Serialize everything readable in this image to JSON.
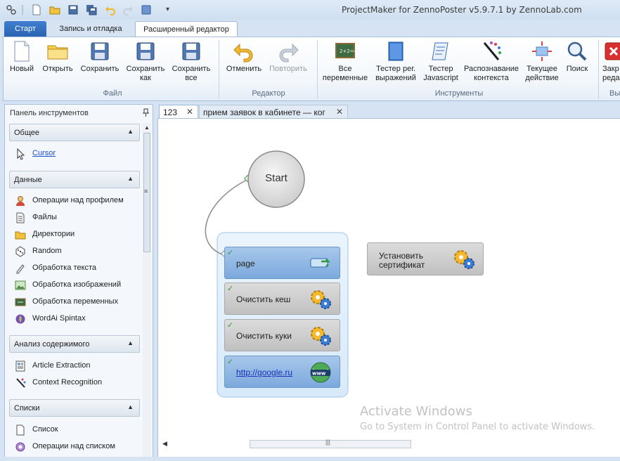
{
  "app": {
    "title": "ProjectMaker for ZennoPoster v5.9.7.1 by ZennoLab.com"
  },
  "quick_access": [
    "app-icon",
    "new-icon",
    "open-icon",
    "save-icon",
    "save-all-icon",
    "undo-icon",
    "redo-icon",
    "layout-icon",
    "customize-icon"
  ],
  "tabs": [
    {
      "label": "Старт",
      "active": false
    },
    {
      "label": "Запись и отладка",
      "active": false
    },
    {
      "label": "Расширенный редактор",
      "active": true
    }
  ],
  "ribbon": {
    "groups": [
      {
        "label": "Файл"
      },
      {
        "label": "Редактор"
      },
      {
        "label": "Инструменты"
      },
      {
        "label": "Вы"
      }
    ],
    "buttons": {
      "new": "Новый",
      "open": "Открыть",
      "save": "Сохранить",
      "save_as_1": "Сохранить",
      "save_as_2": "как",
      "save_all_1": "Сохранить",
      "save_all_2": "все",
      "undo": "Отменить",
      "redo": "Повторить",
      "all_vars_1": "Все",
      "all_vars_2": "переменные",
      "regex_1": "Тестер рег.",
      "regex_2": "выражений",
      "js_1": "Тестер",
      "js_2": "Javascript",
      "ctx_1": "Распознавание",
      "ctx_2": "контекста",
      "cur_1": "Текущее",
      "cur_2": "действие",
      "search": "Поиск",
      "close_1": "Закр",
      "close_2": "реда"
    }
  },
  "toolpanel": {
    "title": "Панель инструментов",
    "pin": "ᵖ",
    "sections": [
      {
        "title": "Общее",
        "items": [
          {
            "label": "Cursor",
            "icon": "cursor-icon"
          }
        ]
      },
      {
        "title": "Данные",
        "items": [
          {
            "label": "Операции над профилем",
            "icon": "profile-icon"
          },
          {
            "label": "Файлы",
            "icon": "file-icon"
          },
          {
            "label": "Директории",
            "icon": "folder-icon"
          },
          {
            "label": "Random",
            "icon": "dice-icon"
          },
          {
            "label": "Обработка текста",
            "icon": "text-edit-icon"
          },
          {
            "label": "Обработка изображений",
            "icon": "image-icon"
          },
          {
            "label": "Обработка переменных",
            "icon": "variables-icon"
          },
          {
            "label": "WordAi Spintax",
            "icon": "wordai-icon"
          }
        ]
      },
      {
        "title": "Анализ содержимого",
        "items": [
          {
            "label": "Article Extraction",
            "icon": "article-icon"
          },
          {
            "label": "Context Recognition",
            "icon": "context-icon"
          }
        ]
      },
      {
        "title": "Списки",
        "items": [
          {
            "label": "Список",
            "icon": "list-icon"
          },
          {
            "label": "Операции над списком",
            "icon": "list-ops-icon"
          }
        ]
      }
    ]
  },
  "doc_tabs": [
    {
      "label": "123",
      "active": true
    },
    {
      "label": "прием заявок в кабинете — ког",
      "active": false
    }
  ],
  "canvas": {
    "start_label": "Start",
    "group_blocks": [
      {
        "label": "page",
        "icon": "tab-arrow-icon",
        "style": "blue"
      },
      {
        "label": "Очистить кеш",
        "icon": "gears-icon",
        "style": "gray"
      },
      {
        "label": "Очистить куки",
        "icon": "gears-icon",
        "style": "gray"
      },
      {
        "label": "http://google.ru",
        "icon": "www-icon",
        "style": "blue"
      }
    ],
    "standalone_block": {
      "label_1": "Установить",
      "label_2": "сертификат",
      "icon": "gears-icon"
    },
    "watermark_title": "Activate Windows",
    "watermark_sub": "Go to System in Control Panel to activate Windows."
  },
  "colors": {
    "accent_tab": "#2a64b2",
    "block_blue": "#7ba9dc",
    "block_gray": "#c0c0c0",
    "check_green": "#2c9c2c"
  }
}
